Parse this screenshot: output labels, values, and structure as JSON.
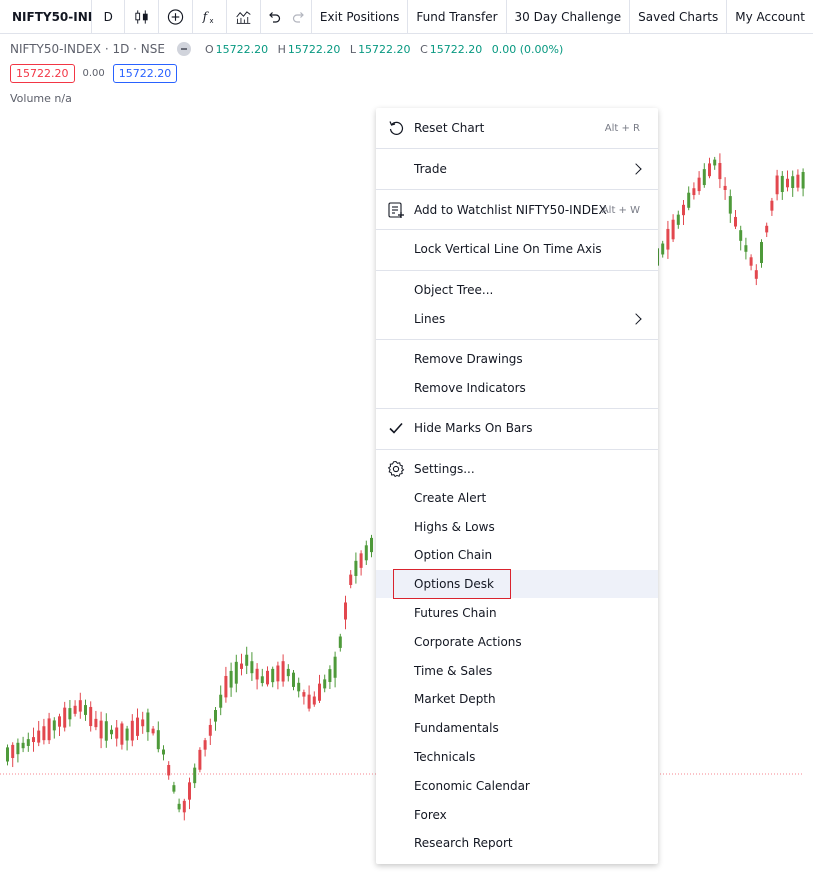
{
  "toolbar": {
    "symbol": "NIFTY50-INI",
    "interval": "D",
    "undo_icon": "undo-icon",
    "redo_icon": "redo-icon",
    "links": [
      "Exit Positions",
      "Fund Transfer",
      "30 Day Challenge",
      "Saved Charts",
      "My Account"
    ]
  },
  "legend": {
    "title": "NIFTY50-INDEX · 1D · NSE",
    "open_label": "O",
    "open": "15722.20",
    "high_label": "H",
    "high": "15722.20",
    "low_label": "L",
    "low": "15722.20",
    "close_label": "C",
    "close": "15722.20",
    "change": "0.00 (0.00%)"
  },
  "prices": {
    "bid": "15722.20",
    "spread": "0.00",
    "ask": "15722.20"
  },
  "volume": "Volume  n/a",
  "colors": {
    "up": "#4e9a3a",
    "down": "#e2474e",
    "accent": "#2962ff",
    "highlight_border": "#d9232e"
  },
  "menu": {
    "reset": {
      "label": "Reset Chart",
      "shortcut": "Alt + R",
      "icon": "reset-icon"
    },
    "trade": {
      "label": "Trade"
    },
    "watchlist": {
      "label": "Add to Watchlist NIFTY50-INDEX",
      "shortcut": "Alt + W",
      "icon": "add-watchlist-icon"
    },
    "lock_line": {
      "label": "Lock Vertical Line On Time Axis"
    },
    "object_tree": {
      "label": "Object Tree..."
    },
    "lines": {
      "label": "Lines"
    },
    "remove_drawings": {
      "label": "Remove Drawings"
    },
    "remove_indicators": {
      "label": "Remove Indicators"
    },
    "hide_marks": {
      "label": "Hide Marks On Bars",
      "checked": true,
      "icon": "checkmark-icon"
    },
    "settings": {
      "label": "Settings...",
      "icon": "gear-icon"
    },
    "create_alert": {
      "label": "Create Alert"
    },
    "highs_lows": {
      "label": "Highs & Lows"
    },
    "option_chain": {
      "label": "Option Chain"
    },
    "options_desk": {
      "label": "Options Desk"
    },
    "futures_chain": {
      "label": "Futures Chain"
    },
    "corporate_actions": {
      "label": "Corporate Actions"
    },
    "time_sales": {
      "label": "Time & Sales"
    },
    "market_depth": {
      "label": "Market Depth"
    },
    "fundamentals": {
      "label": "Fundamentals"
    },
    "technicals": {
      "label": "Technicals"
    },
    "economic_calendar": {
      "label": "Economic Calendar"
    },
    "forex": {
      "label": "Forex"
    },
    "research_report": {
      "label": "Research Report"
    }
  }
}
